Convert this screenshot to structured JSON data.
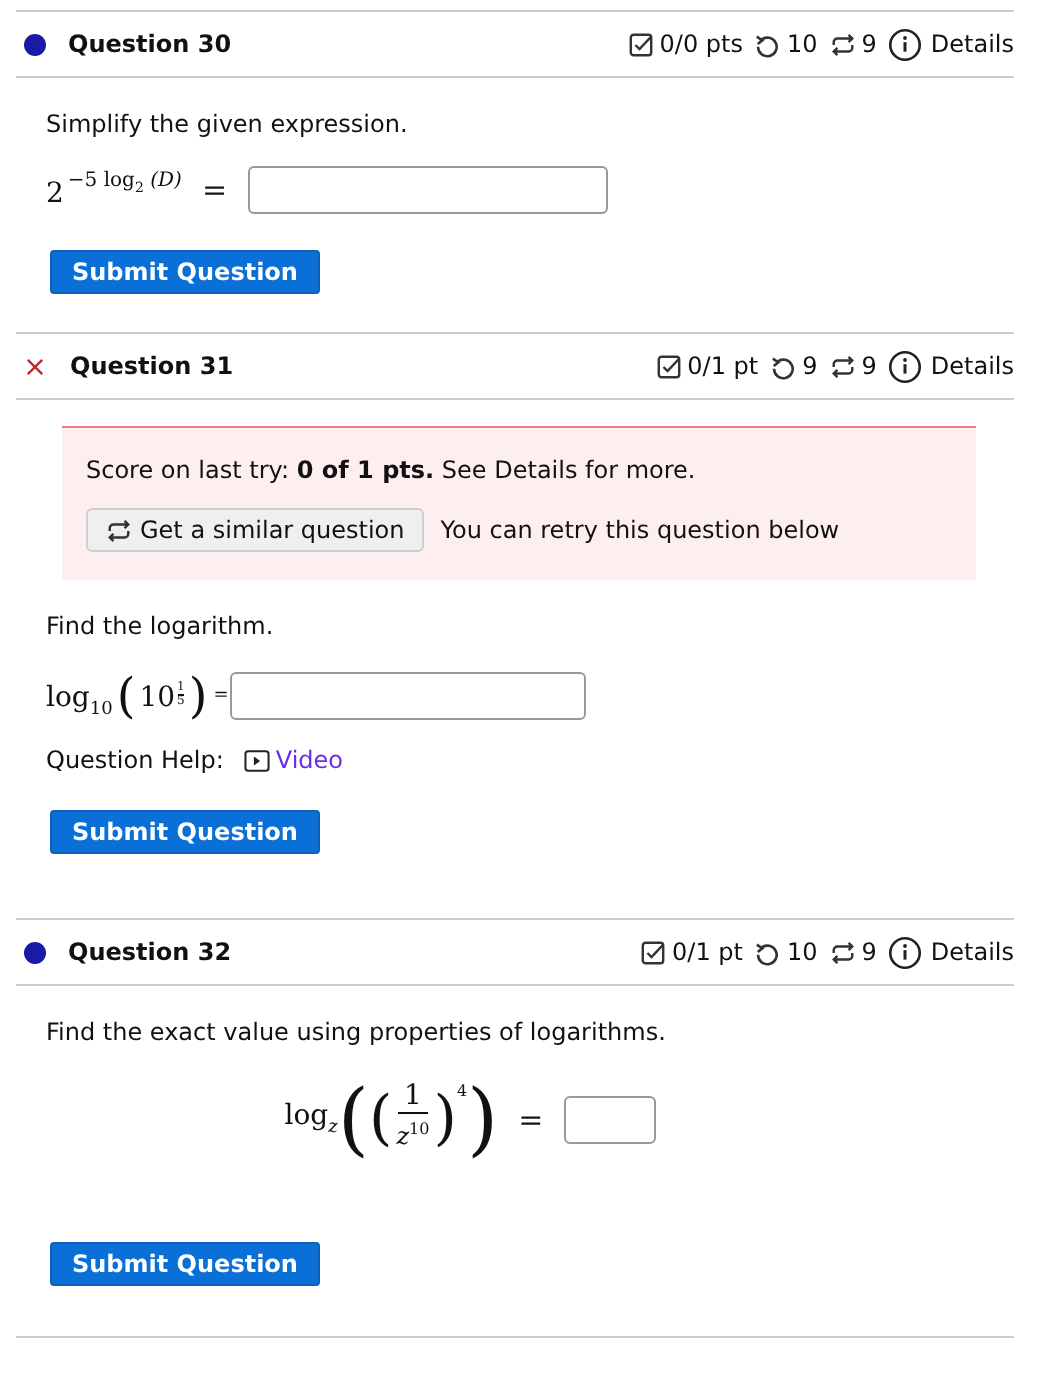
{
  "questions": [
    {
      "kind": "unanswered",
      "title": "Question 30",
      "score": "0/0 pts",
      "retries": "10",
      "versions": "9",
      "details": "Details",
      "prompt": "Simplify the given expression.",
      "math": {
        "kind": "power",
        "base": "2",
        "exp": "−5 log",
        "exp_sub": "2",
        "exp_arg": "(D)",
        "equals": "="
      },
      "submit": "Submit Question"
    },
    {
      "kind": "incorrect",
      "title": "Question 31",
      "score": "0/1 pt",
      "retries": "9",
      "versions": "9",
      "details": "Details",
      "alert": {
        "text": "Score on last try: **0 of 1 pts.** See Details for more.",
        "button": "Get a similar question",
        "note": "You can retry this question below"
      },
      "prompt": "Find the logarithm.",
      "math": {
        "kind": "log_root",
        "log": "log",
        "sub": "10",
        "open": "(",
        "base": "10",
        "num": "1",
        "den": "5",
        "close": ")",
        "equals": "="
      },
      "help": {
        "label": "Question Help:",
        "link": "Video"
      },
      "submit": "Submit Question"
    },
    {
      "kind": "unanswered",
      "title": "Question 32",
      "score": "0/1 pt",
      "retries": "10",
      "versions": "9",
      "details": "Details",
      "prompt": "Find the exact value using properties of logarithms.",
      "math": {
        "kind": "log_fraction",
        "log": "log",
        "sub": "z",
        "open": "(",
        "num": "1",
        "den": "z",
        "den_exp": "10",
        "close": ")",
        "power": "4",
        "equals": "="
      },
      "submit": "Submit Question"
    }
  ]
}
